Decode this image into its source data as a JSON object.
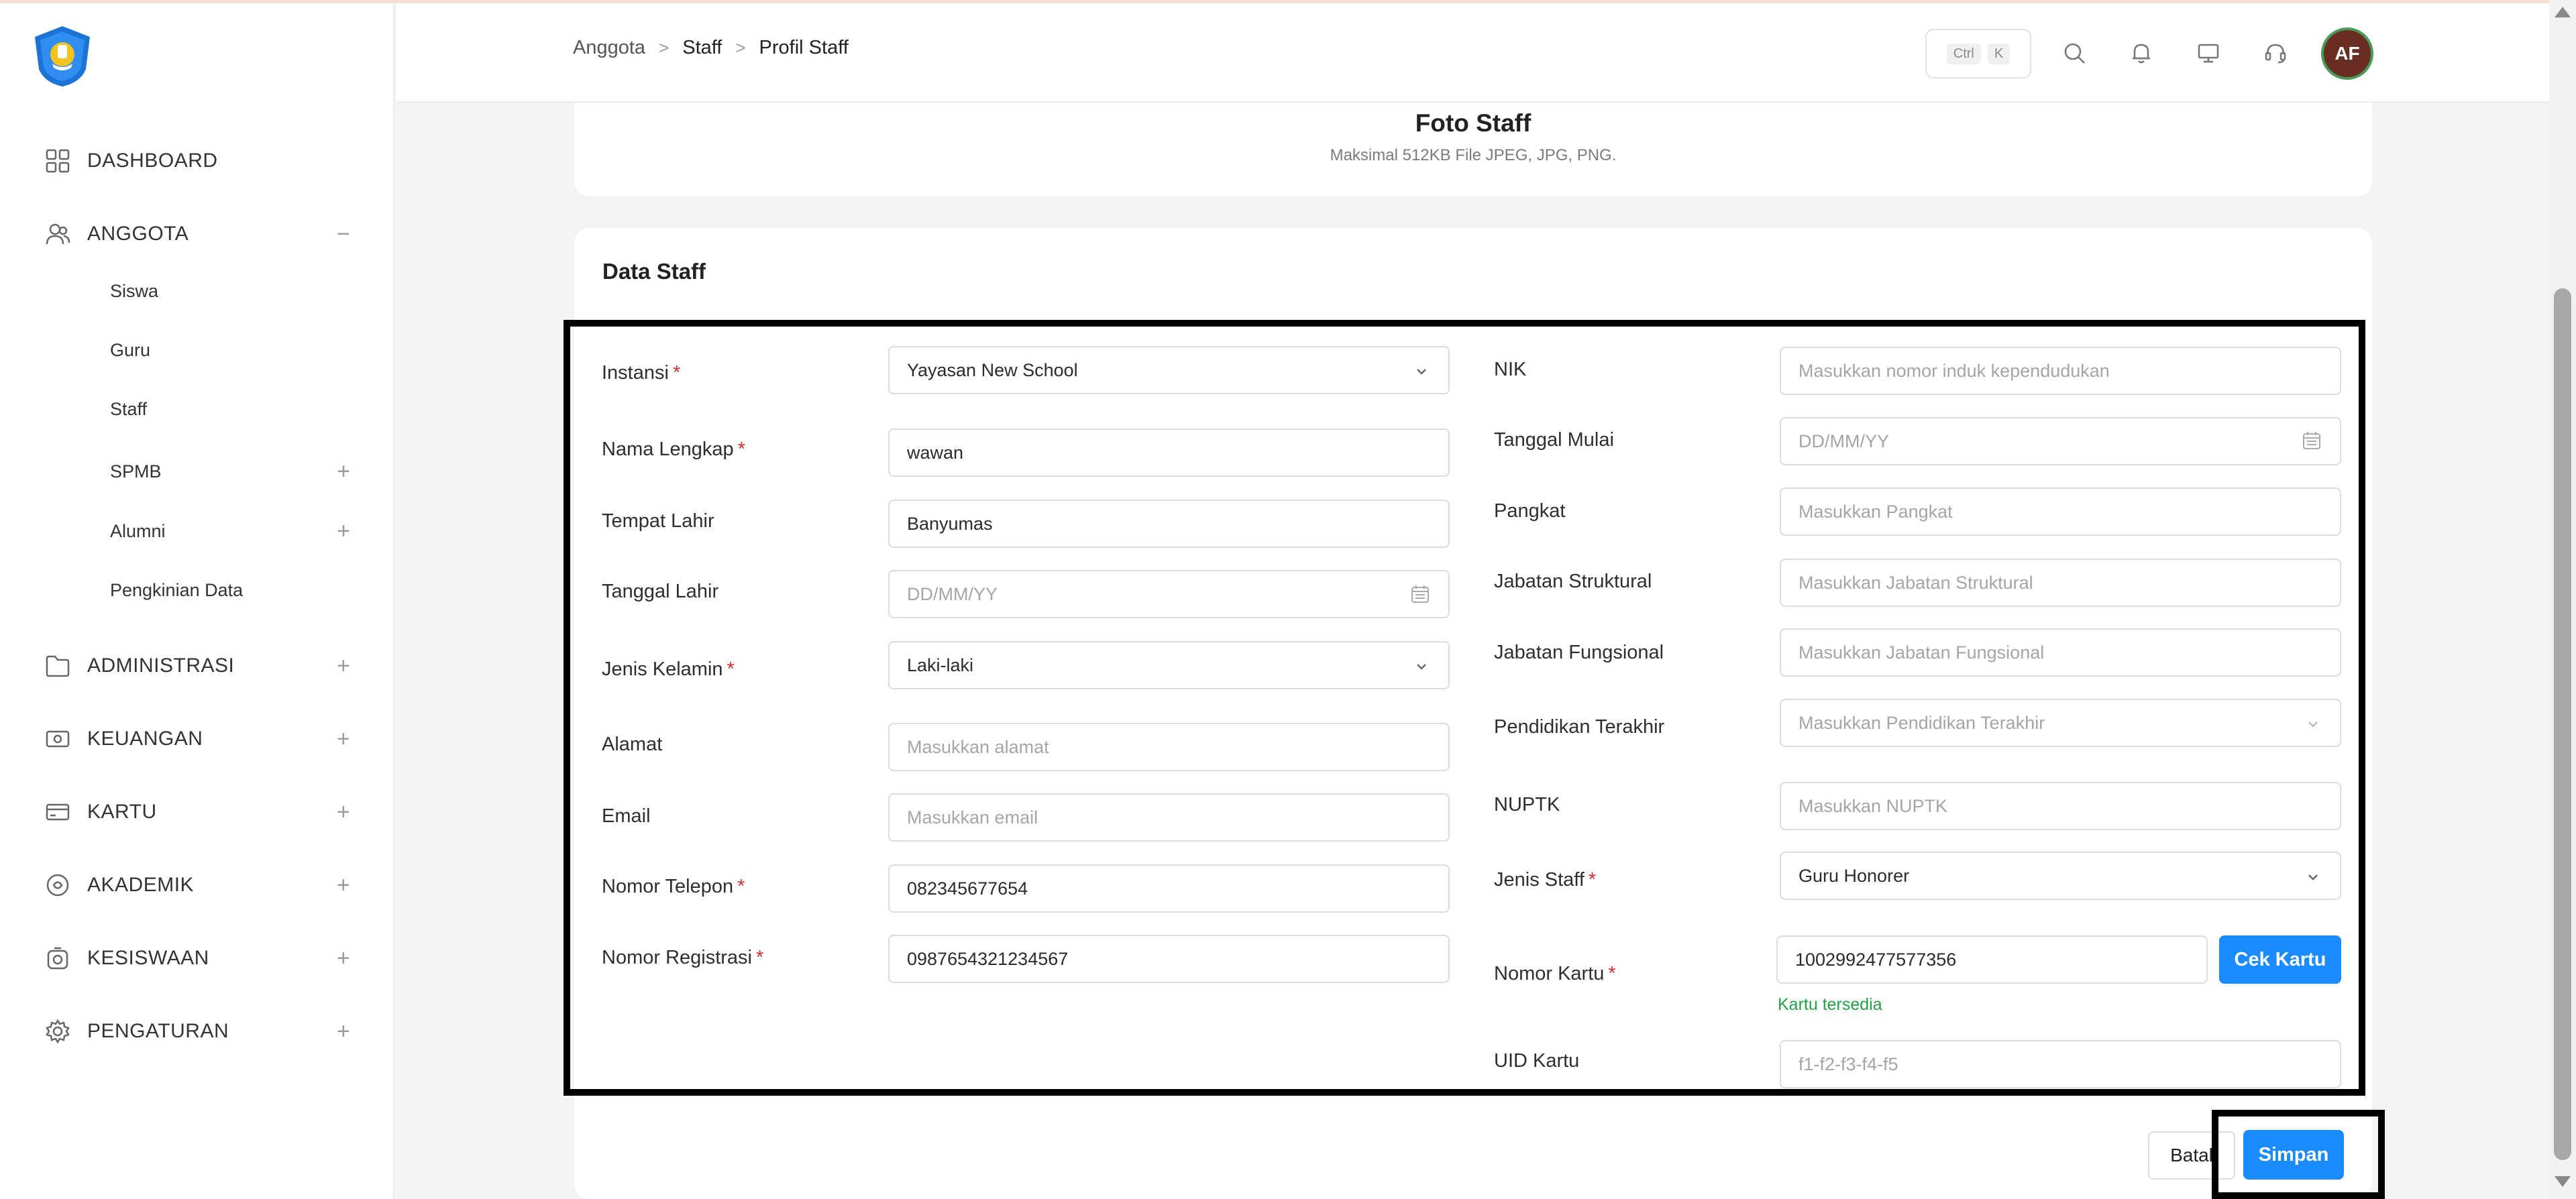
{
  "sidebar": {
    "logo_icon": "tut-wuri-handayani-logo",
    "collapse_icon": "collapse-left-icon",
    "items": [
      {
        "label": "DASHBOARD",
        "icon": "dashboard-icon"
      },
      {
        "label": "ANGGOTA",
        "icon": "users-icon",
        "toggle": "−"
      },
      {
        "label": "ADMINISTRASI",
        "icon": "folder-icon",
        "toggle": "+"
      },
      {
        "label": "KEUANGAN",
        "icon": "money-icon",
        "toggle": "+"
      },
      {
        "label": "KARTU",
        "icon": "card-icon",
        "toggle": "+"
      },
      {
        "label": "AKADEMIK",
        "icon": "academic-icon",
        "toggle": "+"
      },
      {
        "label": "KESISWAAN",
        "icon": "student-affairs-icon",
        "toggle": "+"
      },
      {
        "label": "PENGATURAN",
        "icon": "settings-icon",
        "toggle": "+"
      }
    ],
    "subitems": [
      {
        "label": "Siswa"
      },
      {
        "label": "Guru"
      },
      {
        "label": "Staff"
      },
      {
        "label": "SPMB",
        "toggle": "+"
      },
      {
        "label": "Alumni",
        "toggle": "+"
      },
      {
        "label": "Pengkinian Data"
      }
    ]
  },
  "header": {
    "breadcrumb": [
      "Anggota",
      "Staff",
      "Profil Staff"
    ],
    "breadcrumb_separator": ">",
    "shortcut_keys": [
      "Ctrl",
      "K"
    ],
    "icons": [
      "search-icon",
      "bell-icon",
      "monitor-icon",
      "headset-icon"
    ],
    "avatar_initials": "AF"
  },
  "photo_card": {
    "title": "Foto Staff",
    "subtitle": "Maksimal 512KB File JPEG, JPG, PNG."
  },
  "form": {
    "title": "Data Staff",
    "required_mark": "*",
    "instansi": {
      "label": "Instansi",
      "value": "Yayasan New School"
    },
    "nama_lengkap": {
      "label": "Nama Lengkap",
      "value": "wawan"
    },
    "tempat_lahir": {
      "label": "Tempat Lahir",
      "value": "Banyumas"
    },
    "tanggal_lahir": {
      "label": "Tanggal Lahir",
      "placeholder": "DD/MM/YY"
    },
    "jenis_kelamin": {
      "label": "Jenis Kelamin",
      "value": "Laki-laki"
    },
    "alamat": {
      "label": "Alamat",
      "placeholder": "Masukkan alamat"
    },
    "email": {
      "label": "Email",
      "placeholder": "Masukkan email"
    },
    "nomor_telepon": {
      "label": "Nomor Telepon",
      "value": "082345677654"
    },
    "nomor_registrasi": {
      "label": "Nomor Registrasi",
      "value": "0987654321234567"
    },
    "nik": {
      "label": "NIK",
      "placeholder": "Masukkan nomor induk kependudukan"
    },
    "tanggal_mulai": {
      "label": "Tanggal Mulai",
      "placeholder": "DD/MM/YY"
    },
    "pangkat": {
      "label": "Pangkat",
      "placeholder": "Masukkan Pangkat"
    },
    "jabatan_struktural": {
      "label": "Jabatan Struktural",
      "placeholder": "Masukkan Jabatan Struktural"
    },
    "jabatan_fungsional": {
      "label": "Jabatan Fungsional",
      "placeholder": "Masukkan Jabatan Fungsional"
    },
    "pendidikan_terakhir": {
      "label": "Pendidikan Terakhir",
      "placeholder": "Masukkan Pendidikan Terakhir"
    },
    "nuptk": {
      "label": "NUPTK",
      "placeholder": "Masukkan NUPTK"
    },
    "jenis_staff": {
      "label": "Jenis Staff",
      "value": "Guru Honorer"
    },
    "nomor_kartu": {
      "label": "Nomor Kartu",
      "value": "1002992477577356",
      "status": "Kartu tersedia",
      "check_button": "Cek Kartu"
    },
    "uid_kartu": {
      "label": "UID Kartu",
      "placeholder": "f1-f2-f3-f4-f5"
    }
  },
  "actions": {
    "cancel": "Batal",
    "save": "Simpan"
  },
  "colors": {
    "primary": "#1a8cff",
    "required": "#d92e2e",
    "success": "#21a046",
    "avatar_bg": "#6a2d23",
    "avatar_ring": "#4a9a58"
  }
}
